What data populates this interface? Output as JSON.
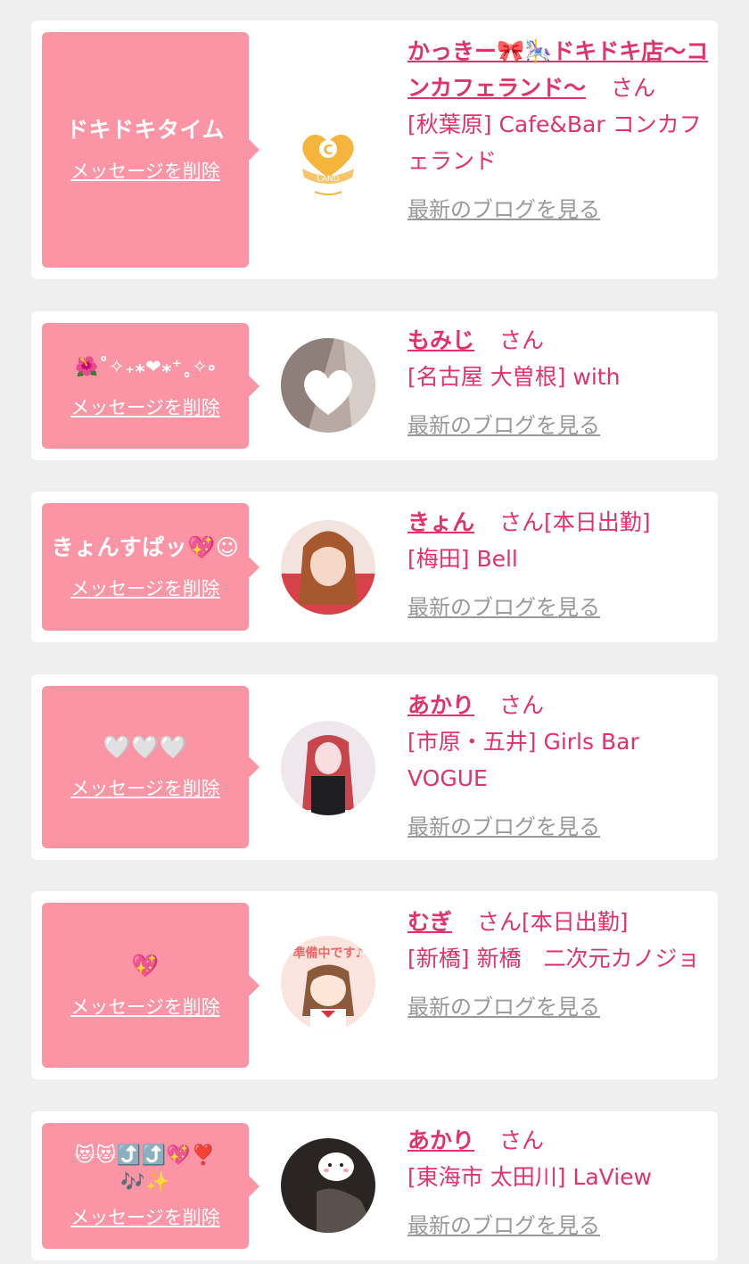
{
  "delete_label": "メッセージを削除",
  "blog_label": "最新のブログを見る",
  "entries": [
    {
      "mood": "ドキドキタイム",
      "name": "かっきー🎀🎠ドキドキ店〜コンカフェランド〜",
      "honorific": "さん",
      "status": "",
      "shop": "[秋葉原] Cafe&Bar コンカフェランド",
      "avatar_icon": "cafe-land-logo-icon"
    },
    {
      "mood": "🌺˚✧₊⁎❤︎⁎⁺˳✧༚",
      "name": "もみじ",
      "honorific": "さん",
      "status": "",
      "shop": "[名古屋 大曽根] with",
      "avatar_icon": "heart-photo-icon"
    },
    {
      "mood": "きょんすぱッ💖☺︎",
      "name": "きょん",
      "honorific": "さん",
      "status": "[本日出勤]",
      "shop": "[梅田] Bell",
      "avatar_icon": "portrait-photo-icon"
    },
    {
      "mood": "🤍🤍🤍",
      "name": "あかり",
      "honorific": "さん",
      "status": "",
      "shop": "[市原・五井] Girls Bar VOGUE",
      "avatar_icon": "portrait-photo-icon"
    },
    {
      "mood": "💖",
      "name": "むぎ",
      "honorific": "さん",
      "status": "[本日出勤]",
      "shop": "[新橋] 新橋　二次元カノジョ",
      "avatar_icon": "preparing-illustration-icon"
    },
    {
      "mood": "😻😻⤴️⤴️💖❣️🎶✨",
      "name": "あかり",
      "honorific": "さん",
      "status": "",
      "shop": "[東海市 太田川] LaView",
      "avatar_icon": "portrait-photo-icon"
    }
  ],
  "avatar_text": {
    "cafe_logo_letter": "C",
    "cafe_logo_banner": "LAND",
    "preparing": "準備中です♪"
  }
}
